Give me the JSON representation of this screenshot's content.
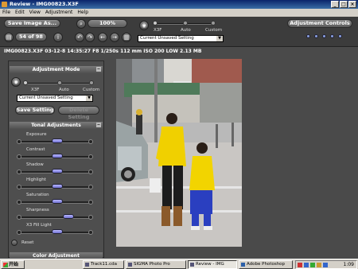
{
  "window": {
    "title": "Review - IMG00823.X3F",
    "buttons": [
      "_",
      "□",
      "×"
    ]
  },
  "menu": [
    "File",
    "Edit",
    "View",
    "Adjustment",
    "Help"
  ],
  "toolbar": {
    "save_image": "Save Image As...",
    "zoom": "100%",
    "page_counter": "54 of 98",
    "mode_labels": [
      "X3F",
      "Auto",
      "Custom"
    ],
    "setting_value": "Current Unsaved Setting",
    "adjustment_controls": "Adjustment Controls"
  },
  "info": {
    "line": "IMG00823.X3F  03-12-8  14:35:27  F8  1/250s  112 mm  ISO 200  LOW  2.13 MB"
  },
  "panel": {
    "adjustment_mode_title": "Adjustment Mode",
    "mode_labels": [
      "X3F",
      "Auto",
      "Custom"
    ],
    "setting_value": "Current Unsaved Setting",
    "save_setting": "Save Setting",
    "delete_setting": "Delete Setting",
    "tonal_title": "Tonal Adjustments",
    "adjustments": [
      {
        "label": "Exposure",
        "value": 0.5
      },
      {
        "label": "Contrast",
        "value": 0.5
      },
      {
        "label": "Shadow",
        "value": 0.5
      },
      {
        "label": "Highlight",
        "value": 0.5
      },
      {
        "label": "Saturation",
        "value": 0.5
      },
      {
        "label": "Sharpness",
        "value": 0.68
      },
      {
        "label": "X3 Fill Light",
        "value": 0.5
      }
    ],
    "reset": "Reset",
    "color_title": "Color Adjustment"
  },
  "taskbar": {
    "start": "开始",
    "tasks": [
      "Track11.cda",
      "SIGMA Photo Pro",
      "Review - IMG",
      "Adobe Photoshop"
    ],
    "clock": "1:09"
  }
}
